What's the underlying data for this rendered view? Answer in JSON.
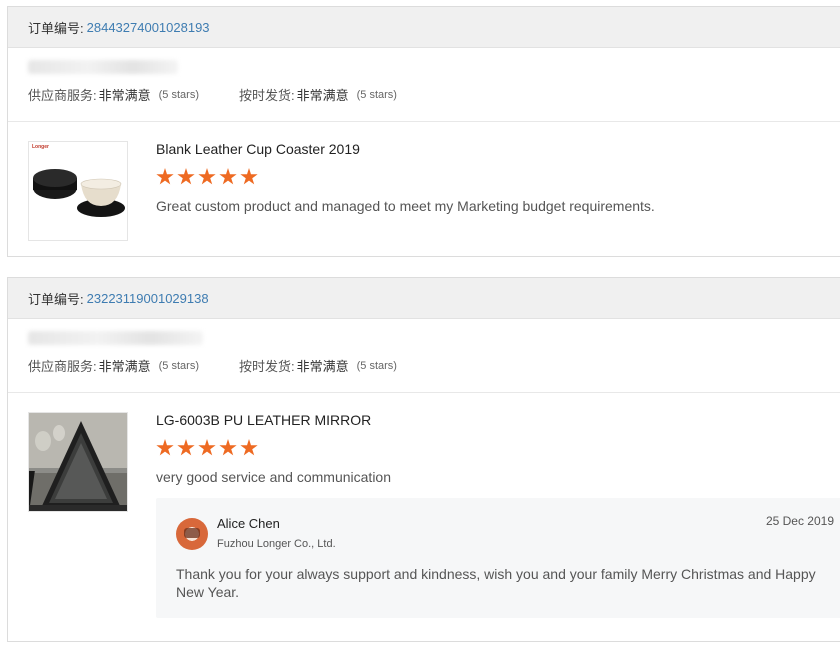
{
  "reviews": [
    {
      "order_label": "订单编号:",
      "order_number": "28443274001028193",
      "buyer_name": "",
      "ratings": {
        "supplier_service_label": "供应商服务:",
        "supplier_service_value": "非常满意",
        "supplier_service_stars": "(5 stars)",
        "shipment_label": "按时发货:",
        "shipment_value": "非常满意",
        "shipment_stars": "(5 stars)"
      },
      "product": {
        "title": "Blank Leather Cup Coaster 2019",
        "rating": 5,
        "comment": "Great custom product and managed to meet my Marketing budget requirements.",
        "image_brand_text": "Longer"
      }
    },
    {
      "order_label": "订单编号:",
      "order_number": "23223119001029138",
      "buyer_name": "",
      "ratings": {
        "supplier_service_label": "供应商服务:",
        "supplier_service_value": "非常满意",
        "supplier_service_stars": "(5 stars)",
        "shipment_label": "按时发货:",
        "shipment_value": "非常满意",
        "shipment_stars": "(5 stars)"
      },
      "product": {
        "title": "LG-6003B PU LEATHER MIRROR",
        "rating": 5,
        "comment": "very good service and communication"
      },
      "reply": {
        "name": "Alice Chen",
        "company": "Fuzhou Longer Co., Ltd.",
        "date": "25 Dec 2019",
        "text": "Thank you for your always support and kindness, wish you and your family Merry Christmas and Happy New Year."
      }
    }
  ],
  "colors": {
    "order_link": "#3e7cb1",
    "star": "#ee6a22",
    "header_bg": "#f0f0f0",
    "reply_bg": "#f6f7f8"
  }
}
